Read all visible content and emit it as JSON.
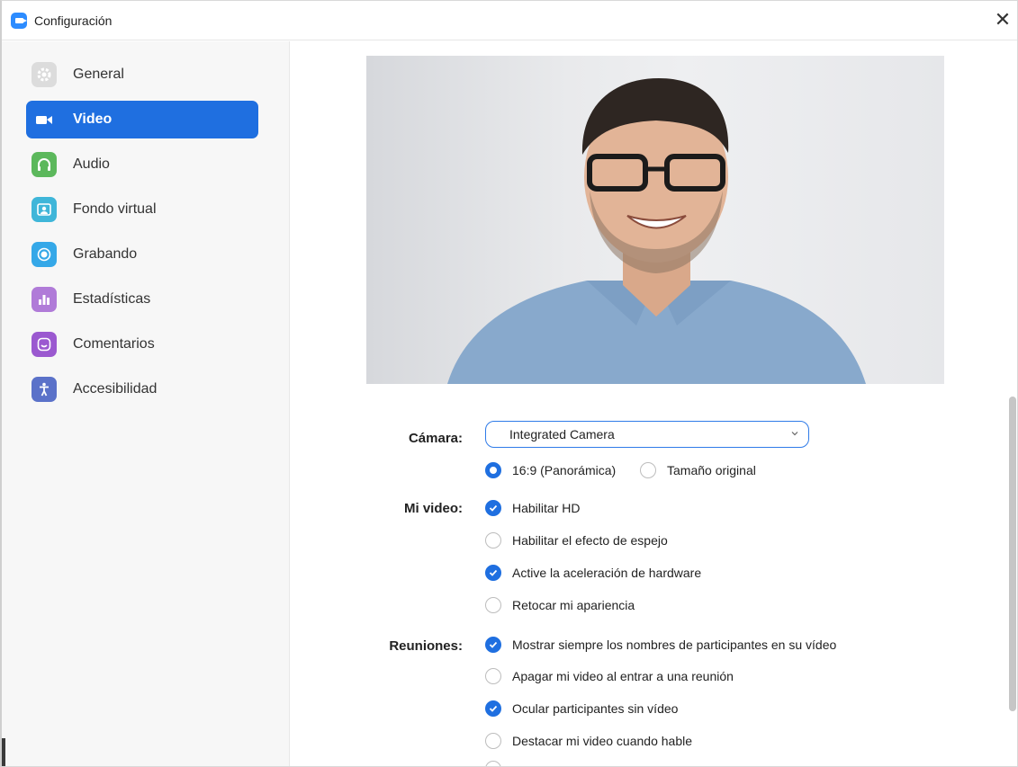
{
  "window": {
    "title": "Configuración"
  },
  "sidebar": {
    "items": [
      {
        "label": "General",
        "icon": "gear-icon",
        "color": "#d9d9d9",
        "active": false
      },
      {
        "label": "Video",
        "icon": "video-camera-icon",
        "color": "#1f6fe0",
        "active": true
      },
      {
        "label": "Audio",
        "icon": "headphones-icon",
        "color": "#5cb85c",
        "active": false
      },
      {
        "label": "Fondo virtual",
        "icon": "person-portrait-icon",
        "color": "#3fb6d9",
        "active": false
      },
      {
        "label": "Grabando",
        "icon": "record-icon",
        "color": "#35a8e8",
        "active": false
      },
      {
        "label": "Estadísticas",
        "icon": "bar-chart-icon",
        "color": "#b07bd8",
        "active": false
      },
      {
        "label": "Comentarios",
        "icon": "smile-icon",
        "color": "#9b59d0",
        "active": false
      },
      {
        "label": "Accesibilidad",
        "icon": "accessibility-icon",
        "color": "#5b72c9",
        "active": false
      }
    ]
  },
  "camera": {
    "label": "Cámara:",
    "selected": "Integrated Camera",
    "aspect_options": [
      {
        "label": "16:9 (Panorámica)",
        "selected": true
      },
      {
        "label": "Tamaño original",
        "selected": false
      }
    ]
  },
  "my_video": {
    "label": "Mi video:",
    "options": [
      {
        "label": "Habilitar HD",
        "checked": true
      },
      {
        "label": "Habilitar el efecto de espejo",
        "checked": false
      },
      {
        "label": "Active la aceleración de hardware",
        "checked": true
      },
      {
        "label": "Retocar mi apariencia",
        "checked": false
      }
    ]
  },
  "meetings": {
    "label": "Reuniones:",
    "options": [
      {
        "label": "Mostrar siempre los nombres de participantes en su vídeo",
        "checked": true
      },
      {
        "label": "Apagar mi video al entrar a una reunión",
        "checked": false
      },
      {
        "label": "Ocular participantes sin vídeo",
        "checked": true
      },
      {
        "label": "Destacar mi video cuando hable",
        "checked": false
      }
    ]
  },
  "accent_color": "#1f6fe0"
}
